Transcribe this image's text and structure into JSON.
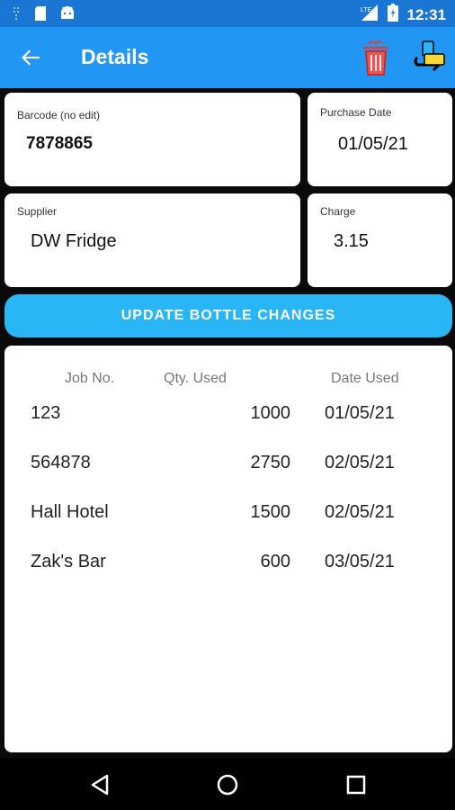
{
  "status_bar": {
    "time": "12:31",
    "icons": [
      "signal-icon",
      "sd-card-icon",
      "android-icon",
      "lte-signal-icon",
      "battery-icon"
    ]
  },
  "app_bar": {
    "title": "Details",
    "back_icon": "arrow-left-icon",
    "delete_icon": "trash-icon",
    "swap_icon": "swap-bottle-icon",
    "color": "#2196f3"
  },
  "fields": {
    "barcode": {
      "label": "Barcode (no edit)",
      "value": "7878865"
    },
    "purchase_date": {
      "label": "Purchase Date",
      "value": "01/05/21"
    },
    "supplier": {
      "label": "Supplier",
      "value": "DW Fridge"
    },
    "charge": {
      "label": "Charge",
      "value": "3.15"
    }
  },
  "update_button": {
    "label": "UPDATE BOTTLE CHANGES",
    "color": "#29b6f6"
  },
  "table": {
    "headers": [
      "Job No.",
      "Qty. Used",
      "Date Used"
    ],
    "rows": [
      {
        "job": "123",
        "qty": "1000",
        "date": "01/05/21"
      },
      {
        "job": "564878",
        "qty": "2750",
        "date": "02/05/21"
      },
      {
        "job": "Hall Hotel",
        "qty": "1500",
        "date": "02/05/21"
      },
      {
        "job": "Zak's Bar",
        "qty": "600",
        "date": "03/05/21"
      }
    ]
  },
  "nav_bar": {
    "icons": [
      "back-triangle-icon",
      "home-circle-icon",
      "recents-square-icon"
    ]
  }
}
